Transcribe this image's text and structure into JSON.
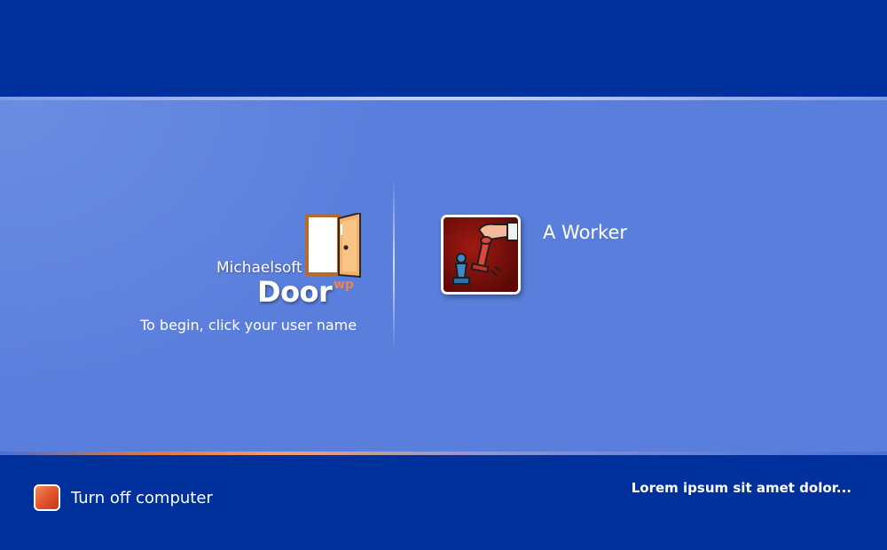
{
  "logo": {
    "brand": "Michaelsoft",
    "product": "Door",
    "edition": "wp",
    "icon": "door-icon"
  },
  "instruction": "To begin, click your user name",
  "users": [
    {
      "name": "A Worker",
      "avatar_icon": "chess-knockdown-icon"
    }
  ],
  "power": {
    "label": "Turn off computer",
    "icon": "power-icon"
  },
  "footer": {
    "text": "Lorem ipsum sit amet dolor..."
  },
  "colors": {
    "top_band": "#00309c",
    "main_panel": "#5a7edc",
    "accent_orange": "#e0502a",
    "text": "#ffffff"
  }
}
